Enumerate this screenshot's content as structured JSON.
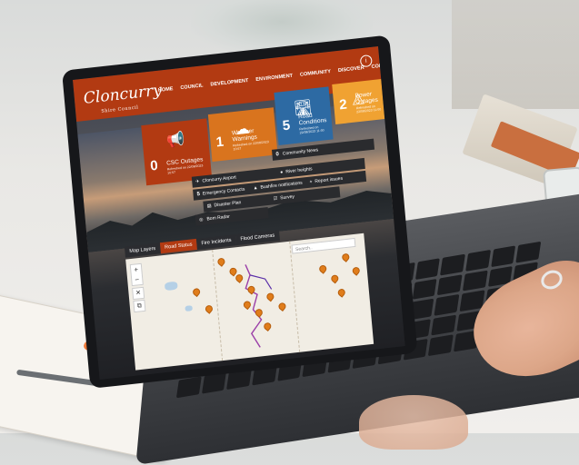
{
  "site": {
    "logo_main": "Cloncurry",
    "logo_sub": "Shire Council",
    "info_icon": "i"
  },
  "nav": {
    "items": [
      "HOME",
      "COUNCIL",
      "DEVELOPMENT",
      "ENVIRONMENT",
      "COMMUNITY",
      "DISCOVER",
      "CONTACT"
    ]
  },
  "tiles": [
    {
      "num": "0",
      "label": "CSC Outages",
      "ref": "Refreshed on 22/08/2023 10:57",
      "icon": "megaphone-icon",
      "color": "#b23a12"
    },
    {
      "num": "1",
      "label": "Weather Warnings",
      "ref": "Refreshed on 22/08/2023 10:57",
      "icon": "cloud-icon",
      "color": "#d9741e"
    },
    {
      "num": "5",
      "label": "Road Conditions",
      "ref": "Refreshed on 22/08/2023 11:00",
      "icon": "road-icon",
      "color": "#2d6aa3"
    },
    {
      "num": "2",
      "label": "Power Outages",
      "ref": "Refreshed on 22/08/2023 11:00",
      "icon": "warning-icon",
      "color": "#f0a232"
    }
  ],
  "info_bars": {
    "row1": {
      "num": "0",
      "label": "Community News"
    },
    "row2": {
      "left": "Cloncurry Airport",
      "right": "River heights"
    },
    "row3": {
      "num": "5",
      "left": "Emergency Contacts",
      "mid": "Bushfire notifications",
      "right": "Report issues"
    },
    "row4": {
      "left": "Disaster Plan",
      "right": "Survey"
    },
    "row5": {
      "left": "Bom Radar"
    }
  },
  "map_tabs": [
    {
      "label": "Map Layers",
      "active": false
    },
    {
      "label": "Road Status",
      "active": true
    },
    {
      "label": "Fire Incidents",
      "active": false
    },
    {
      "label": "Flood Cameras",
      "active": false
    }
  ],
  "map": {
    "search_placeholder": "Search..",
    "zoom_in": "+",
    "zoom_out": "−",
    "close_tool": "✕",
    "layers_tool": "⧉"
  }
}
